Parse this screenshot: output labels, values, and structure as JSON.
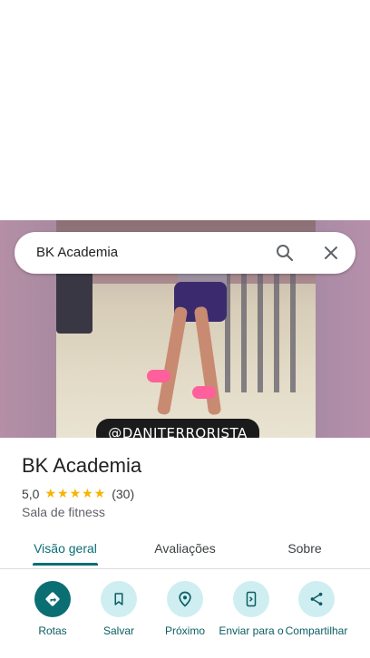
{
  "search": {
    "query": "BK Academia"
  },
  "photo": {
    "watermark": "@DANITERRORISTA"
  },
  "place": {
    "name": "BK Academia",
    "rating": "5,0",
    "stars": "★★★★★",
    "review_count": "(30)",
    "category": "Sala de fitness"
  },
  "tabs": [
    {
      "label": "Visão geral"
    },
    {
      "label": "Avaliações"
    },
    {
      "label": "Sobre"
    }
  ],
  "actions": [
    {
      "label": "Rotas",
      "icon": "directions-icon"
    },
    {
      "label": "Salvar",
      "icon": "bookmark-icon"
    },
    {
      "label": "Próximo",
      "icon": "nearby-icon"
    },
    {
      "label": "Enviar para o",
      "icon": "send-to-phone-icon"
    },
    {
      "label": "Compartilhar",
      "icon": "share-icon"
    }
  ],
  "colors": {
    "accent": "#0b6e73",
    "chip_bg": "#cfeef1",
    "star": "#f5b400"
  }
}
